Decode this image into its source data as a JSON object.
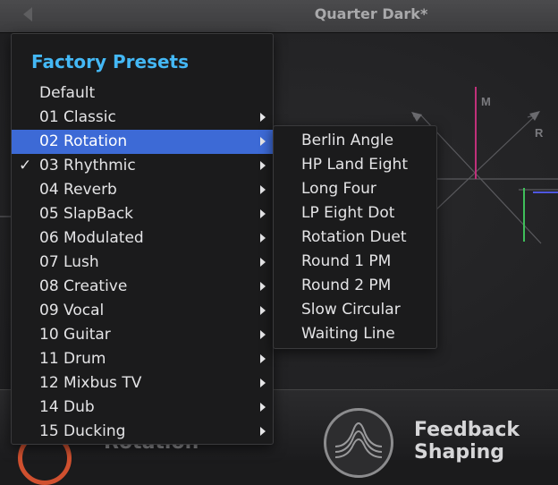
{
  "header": {
    "preset_name": "Quarter Dark*"
  },
  "display": {
    "axis_labels": {
      "m": "M",
      "r": "R"
    }
  },
  "bottom_panel": {
    "rotation_label": "Rotation",
    "feedback_label_line1": "Feedback",
    "feedback_label_line2": "Shaping"
  },
  "preset_menu": {
    "title": "Factory Presets",
    "items": [
      {
        "label": "Default",
        "has_submenu": false,
        "checked": false,
        "selected": false
      },
      {
        "label": "01 Classic",
        "has_submenu": true,
        "checked": false,
        "selected": false
      },
      {
        "label": "02 Rotation",
        "has_submenu": true,
        "checked": false,
        "selected": true
      },
      {
        "label": "03 Rhythmic",
        "has_submenu": true,
        "checked": true,
        "selected": false
      },
      {
        "label": "04 Reverb",
        "has_submenu": true,
        "checked": false,
        "selected": false
      },
      {
        "label": "05 SlapBack",
        "has_submenu": true,
        "checked": false,
        "selected": false
      },
      {
        "label": "06 Modulated",
        "has_submenu": true,
        "checked": false,
        "selected": false
      },
      {
        "label": "07 Lush",
        "has_submenu": true,
        "checked": false,
        "selected": false
      },
      {
        "label": "08 Creative",
        "has_submenu": true,
        "checked": false,
        "selected": false
      },
      {
        "label": "09 Vocal",
        "has_submenu": true,
        "checked": false,
        "selected": false
      },
      {
        "label": "10 Guitar",
        "has_submenu": true,
        "checked": false,
        "selected": false
      },
      {
        "label": "11 Drum",
        "has_submenu": true,
        "checked": false,
        "selected": false
      },
      {
        "label": "12 Mixbus TV",
        "has_submenu": true,
        "checked": false,
        "selected": false
      },
      {
        "label": "14 Dub",
        "has_submenu": true,
        "checked": false,
        "selected": false
      },
      {
        "label": "15 Ducking",
        "has_submenu": true,
        "checked": false,
        "selected": false
      }
    ],
    "check_glyph": "✓"
  },
  "submenu": {
    "items": [
      "Berlin Angle",
      "HP Land Eight",
      "Long Four",
      "LP Eight Dot",
      "Rotation Duet",
      "Round 1 PM",
      "Round 2 PM",
      "Slow Circular",
      "Waiting Line"
    ]
  },
  "colors": {
    "menu_title": "#44b8f5",
    "selection": "#3d6ad6",
    "m_axis": "#c0307a",
    "green_line": "#3fbf5a",
    "blue_line": "#4f57e0",
    "rotation_accent": "#d0502f"
  }
}
